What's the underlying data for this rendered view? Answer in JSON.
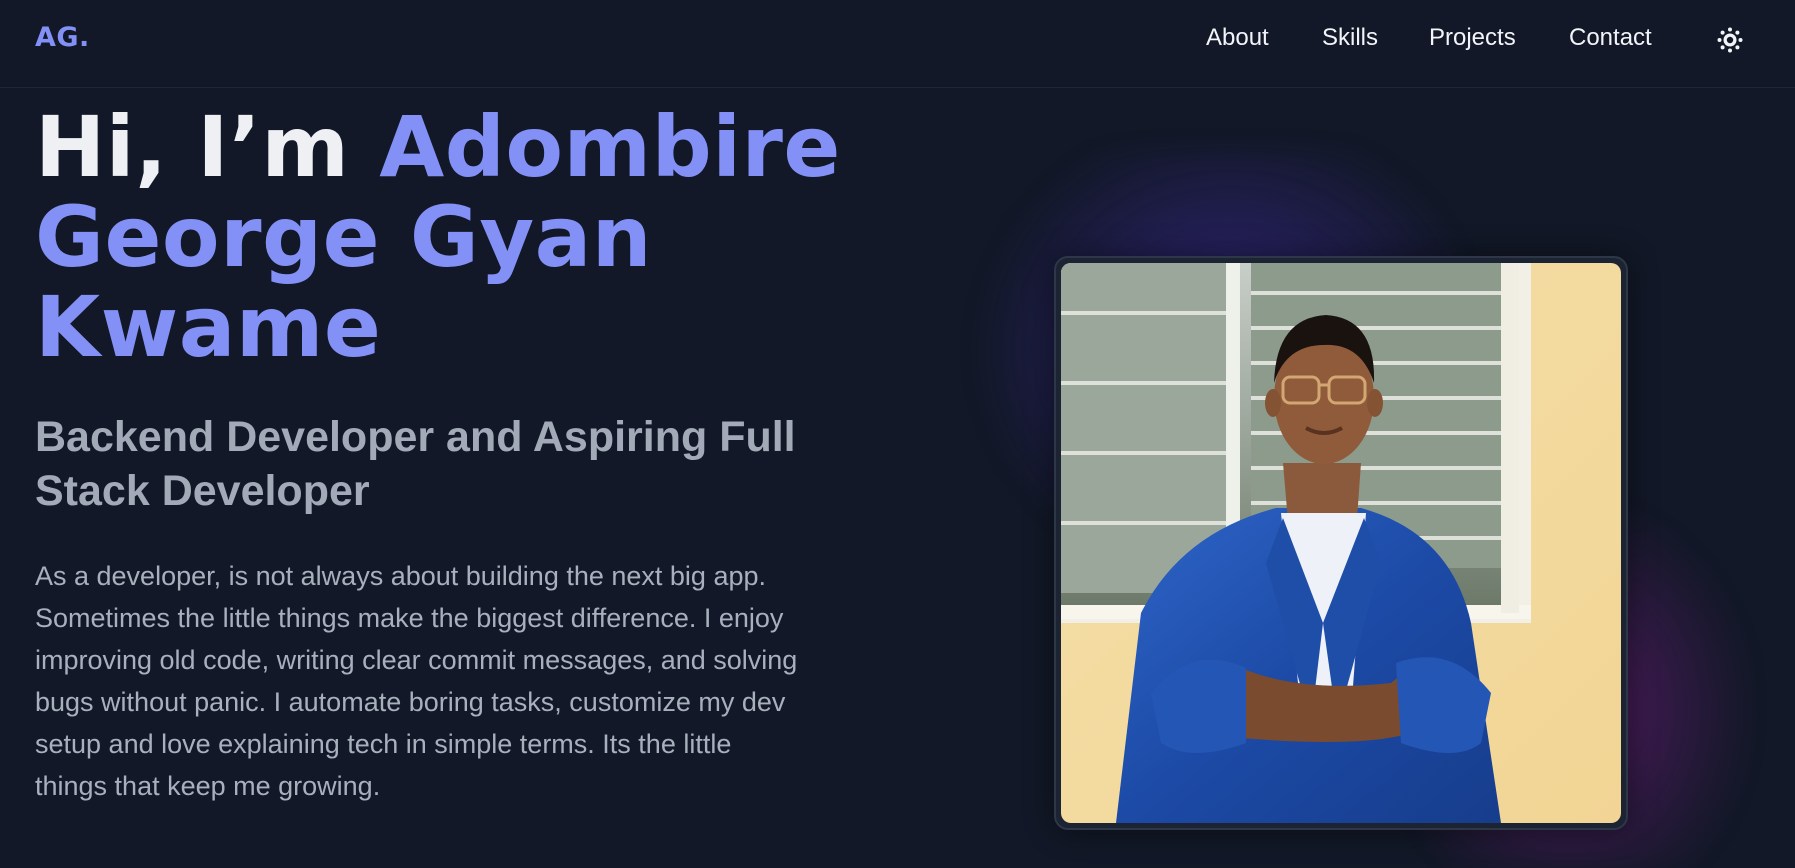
{
  "nav": {
    "logo": "AG.",
    "links": [
      "About",
      "Skills",
      "Projects",
      "Contact"
    ],
    "theme_icon": "sun-icon"
  },
  "hero": {
    "greeting": "Hi, I’m ",
    "name_line1": "Adombire",
    "name_line2": "George Gyan",
    "name_line3": "Kwame",
    "subtitle": "Backend Developer and Aspiring Full Stack Developer",
    "description": "As a developer, is not always about building the next big app. Sometimes the little things make the biggest difference. I enjoy improving old code, writing clear commit messages, and solving bugs without panic. I automate boring tasks, customize my dev setup and love explaining tech in simple terms. Its the little things that keep me growing."
  },
  "colors": {
    "background": "#121827",
    "accent": "#8391f6",
    "text_primary": "#eef0f3",
    "text_muted": "#a2a9b7"
  }
}
